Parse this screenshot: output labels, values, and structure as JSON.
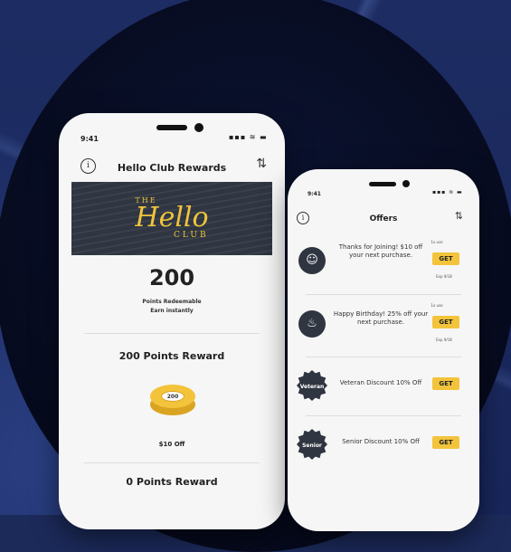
{
  "main_phone": {
    "time": "9:41",
    "status_icons": "▪▪▪ ≋ ▬",
    "title": "Hello Club Rewards",
    "logo": {
      "the": "THE",
      "hello": "Hello",
      "club": "CLUB"
    },
    "points": {
      "value": "200",
      "line1": "Points Redeemable",
      "line2": "Earn instantly"
    },
    "reward1": {
      "title": "200 Points Reward",
      "coin_label": "200",
      "off": "$10 Off"
    },
    "reward2": {
      "title": "0 Points Reward"
    }
  },
  "offers_phone": {
    "time": "9:41",
    "status_icons": "▪▪▪ ≋ ▬",
    "title": "Offers",
    "items": [
      {
        "text": "Thanks for Joining! $10 off your next purchase.",
        "uses": "1x use",
        "button": "GET",
        "expires": "Exp 9/18",
        "icon": "waving-person-icon"
      },
      {
        "text": "Happy Birthday! 25% off your next purchase.",
        "uses": "1x use",
        "button": "GET",
        "expires": "Exp 9/18",
        "icon": "birthday-cake-icon"
      },
      {
        "text": "Veteran Discount 10% Off",
        "button": "GET",
        "badge": "Veteran"
      },
      {
        "text": "Senior Discount 10% Off",
        "button": "GET",
        "badge": "Senior"
      }
    ]
  },
  "colors": {
    "accent": "#f3c43b",
    "dark": "#2f3541",
    "background": "#1c2a5a"
  }
}
